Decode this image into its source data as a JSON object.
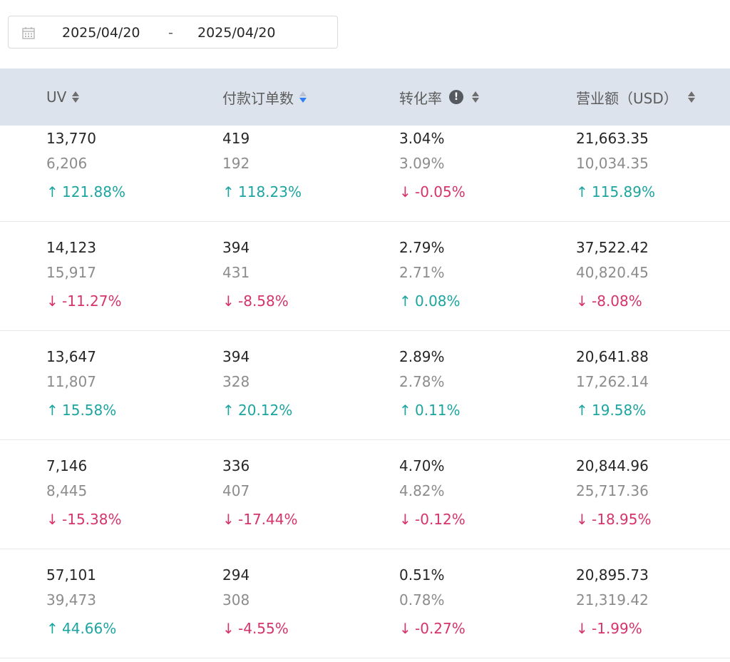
{
  "date_range": {
    "start": "2025/04/20",
    "separator": "-",
    "end": "2025/04/20"
  },
  "columns": [
    {
      "label": "UV",
      "sort": "none",
      "info": false
    },
    {
      "label": "付款订单数",
      "sort": "desc",
      "info": false
    },
    {
      "label": "转化率",
      "sort": "none",
      "info": true,
      "info_glyph": "!"
    },
    {
      "label": "营业额（USD）",
      "sort": "none",
      "info": false
    }
  ],
  "rows": [
    {
      "cells": [
        {
          "current": "13,770",
          "previous": "6,206",
          "change": "121.88%",
          "dir": "up"
        },
        {
          "current": "419",
          "previous": "192",
          "change": "118.23%",
          "dir": "up"
        },
        {
          "current": "3.04%",
          "previous": "3.09%",
          "change": "-0.05%",
          "dir": "down"
        },
        {
          "current": "21,663.35",
          "previous": "10,034.35",
          "change": "115.89%",
          "dir": "up"
        }
      ]
    },
    {
      "cells": [
        {
          "current": "14,123",
          "previous": "15,917",
          "change": "-11.27%",
          "dir": "down"
        },
        {
          "current": "394",
          "previous": "431",
          "change": "-8.58%",
          "dir": "down"
        },
        {
          "current": "2.79%",
          "previous": "2.71%",
          "change": "0.08%",
          "dir": "up"
        },
        {
          "current": "37,522.42",
          "previous": "40,820.45",
          "change": "-8.08%",
          "dir": "down"
        }
      ]
    },
    {
      "cells": [
        {
          "current": "13,647",
          "previous": "11,807",
          "change": "15.58%",
          "dir": "up"
        },
        {
          "current": "394",
          "previous": "328",
          "change": "20.12%",
          "dir": "up"
        },
        {
          "current": "2.89%",
          "previous": "2.78%",
          "change": "0.11%",
          "dir": "up"
        },
        {
          "current": "20,641.88",
          "previous": "17,262.14",
          "change": "19.58%",
          "dir": "up"
        }
      ]
    },
    {
      "cells": [
        {
          "current": "7,146",
          "previous": "8,445",
          "change": "-15.38%",
          "dir": "down"
        },
        {
          "current": "336",
          "previous": "407",
          "change": "-17.44%",
          "dir": "down"
        },
        {
          "current": "4.70%",
          "previous": "4.82%",
          "change": "-0.12%",
          "dir": "down"
        },
        {
          "current": "20,844.96",
          "previous": "25,717.36",
          "change": "-18.95%",
          "dir": "down"
        }
      ]
    },
    {
      "cells": [
        {
          "current": "57,101",
          "previous": "39,473",
          "change": "44.66%",
          "dir": "up"
        },
        {
          "current": "294",
          "previous": "308",
          "change": "-4.55%",
          "dir": "down"
        },
        {
          "current": "0.51%",
          "previous": "0.78%",
          "change": "-0.27%",
          "dir": "down"
        },
        {
          "current": "20,895.73",
          "previous": "21,319.42",
          "change": "-1.99%",
          "dir": "down"
        }
      ]
    }
  ],
  "arrows": {
    "up": "↑",
    "down": "↓"
  },
  "colors": {
    "up": "#1ca5a0",
    "down": "#d6336c",
    "header_bg": "#dde3ec",
    "active_sort": "#2f7ef5"
  }
}
